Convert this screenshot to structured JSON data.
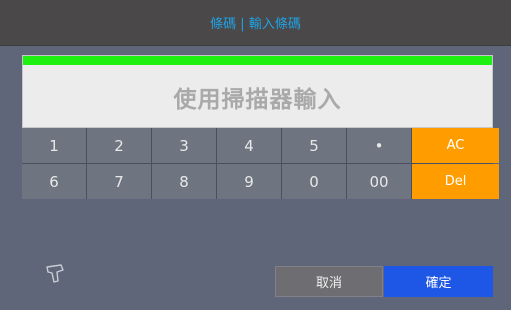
{
  "header": {
    "title": "條碼 | 輸入條碼"
  },
  "display": {
    "placeholder": "使用掃描器輸入",
    "bar_color": "#1ef012"
  },
  "keypad": {
    "row1": [
      "1",
      "2",
      "3",
      "4",
      "5",
      "•",
      "AC"
    ],
    "row2": [
      "6",
      "7",
      "8",
      "9",
      "0",
      "00",
      "Del"
    ]
  },
  "icons": {
    "scanner": "barcode-scanner-icon"
  },
  "buttons": {
    "cancel": "取消",
    "confirm": "確定"
  },
  "colors": {
    "accent": "#1fa3e6",
    "function_key": "#fe9c00",
    "confirm": "#1e56e6"
  }
}
